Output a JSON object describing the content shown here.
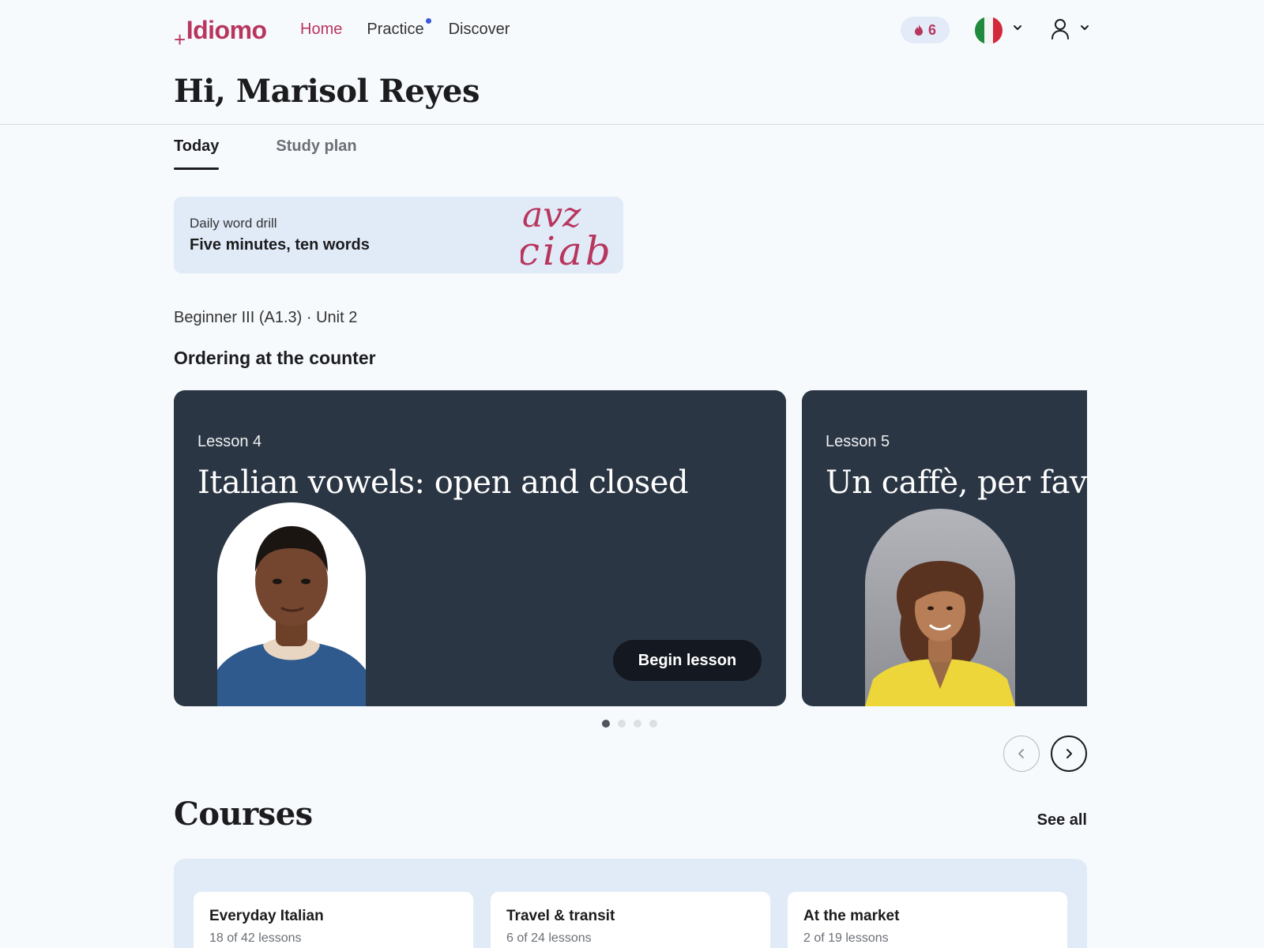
{
  "app": {
    "logo_plus": "+",
    "logo_text": "Idiomo"
  },
  "nav": {
    "home": "Home",
    "practice": "Practice",
    "discover": "Discover"
  },
  "streak": {
    "count": "6"
  },
  "greeting": "Hi, Marisol Reyes",
  "tabs": {
    "today": "Today",
    "study_plan": "Study plan"
  },
  "drill": {
    "subtitle": "Daily word drill",
    "title": "Five minutes, ten words",
    "letters_row1": "avz",
    "letters_row2": "ciab"
  },
  "unit": {
    "meta": "Beginner III (A1.3) · Unit 2",
    "title": "Ordering at the counter"
  },
  "lessons": [
    {
      "label": "Lesson 4",
      "title": "Italian vowels: open and closed",
      "cta": "Begin lesson"
    },
    {
      "label": "Lesson 5",
      "title": "Un caffè, per favore"
    }
  ],
  "carousel": {
    "page_count": 4,
    "active_page": 1
  },
  "courses": {
    "title": "Courses",
    "see_all": "See all",
    "items": [
      {
        "name": "Everyday Italian",
        "progress_text": "18 of 42 lessons",
        "completed": 18,
        "total": 42
      },
      {
        "name": "Travel & transit",
        "progress_text": "6 of 24 lessons",
        "completed": 6,
        "total": 24
      },
      {
        "name": "At the market",
        "progress_text": "2 of 19 lessons",
        "completed": 2,
        "total": 19
      }
    ]
  },
  "colors": {
    "brand": "#b8365d",
    "card_bg": "#2b3645",
    "panel_bg": "#e1ebf8",
    "notification_dot": "#3d5bd6"
  },
  "icons": [
    "flame-icon",
    "italy-flag-icon",
    "chevron-down-icon",
    "user-icon",
    "chevron-left-icon",
    "chevron-right-icon"
  ]
}
